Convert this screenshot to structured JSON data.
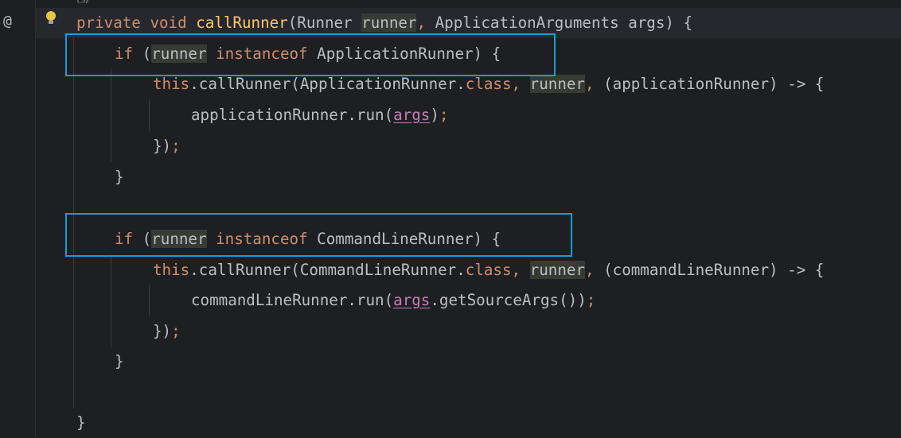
{
  "gutter": {
    "at_symbol": "@",
    "bulb_icon": "lightbulb-icon"
  },
  "top_fragment": "ℰ𝒹 ·",
  "colors": {
    "keyword": "#cf8e6d",
    "method": "#ffc66d",
    "highlight": "#373b34",
    "box": "#1e9ad6",
    "param_underline": "#c77dbb"
  },
  "code": {
    "l1": {
      "kw1": "private",
      "kw2": "void",
      "name": "callRunner",
      "open": "(Runner ",
      "runner": "runner",
      "comma": ",",
      "rest": " ApplicationArguments args) {"
    },
    "l2": {
      "if": "if",
      "open": " (",
      "runner": "runner",
      "space": " ",
      "instanceof": "instanceof",
      "type": " ApplicationRunner) {"
    },
    "l3": {
      "this": "this",
      "call": ".callRunner(ApplicationRunner.",
      "class": "class",
      "comma1": ",",
      "sp": " ",
      "runner": "runner",
      "comma2": ",",
      "lambda": " (applicationRunner) -> {"
    },
    "l4": {
      "text": "applicationRunner.run(",
      "args": "args",
      "close": ")",
      "semi": ";"
    },
    "l5": {
      "close": "})",
      "semi": ";"
    },
    "l6": "}",
    "l7": {
      "if": "if",
      "open": " (",
      "runner": "runner",
      "space": " ",
      "instanceof": "instanceof",
      "type": " CommandLineRunner) {"
    },
    "l8": {
      "this": "this",
      "call": ".callRunner(CommandLineRunner.",
      "class": "class",
      "comma1": ",",
      "sp": " ",
      "runner": "runner",
      "comma2": ",",
      "lambda": " (commandLineRunner) -> {"
    },
    "l9": {
      "text": "commandLineRunner.run(",
      "args": "args",
      "rest": ".getSourceArgs())",
      "semi": ";"
    },
    "l10": {
      "close": "})",
      "semi": ";"
    },
    "l11": "}",
    "l12": "}"
  }
}
